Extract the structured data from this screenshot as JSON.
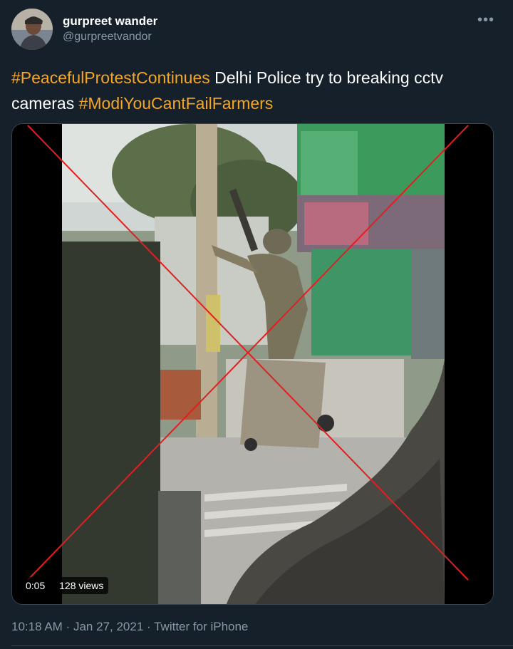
{
  "tweet": {
    "display_name": "gurpreet wander",
    "handle": "@gurpreetvandor",
    "more_icon": "more-horizontal-icon",
    "text_parts": [
      {
        "text": "#PeacefulProtestContinues",
        "kind": "hashtag"
      },
      {
        "text": " Delhi Police try to breaking cctv cameras ",
        "kind": "plain"
      },
      {
        "text": "#ModiYouCantFailFarmers",
        "kind": "hashtag"
      }
    ],
    "hashtag_color": "#f5a623",
    "video": {
      "duration": "0:05",
      "views": "128 views",
      "overlay_cross_color": "#e02020"
    },
    "time": "10:18 AM",
    "date": "Jan 27, 2021",
    "separator": "·",
    "source": "Twitter for iPhone"
  }
}
